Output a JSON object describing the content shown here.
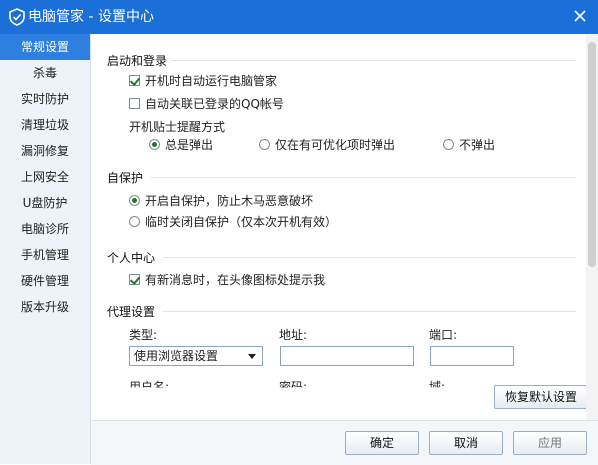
{
  "window": {
    "title": "电脑管家 - 设置中心"
  },
  "sidebar": {
    "items": [
      {
        "label": "常规设置",
        "active": true
      },
      {
        "label": "杀毒"
      },
      {
        "label": "实时防护"
      },
      {
        "label": "清理垃圾"
      },
      {
        "label": "漏洞修复"
      },
      {
        "label": "上网安全"
      },
      {
        "label": "U盘防护"
      },
      {
        "label": "电脑诊所"
      },
      {
        "label": "手机管理"
      },
      {
        "label": "硬件管理"
      },
      {
        "label": "版本升级"
      }
    ]
  },
  "startup": {
    "title": "启动和登录",
    "auto_run": {
      "label": "开机时自动运行电脑管家",
      "checked": true
    },
    "auto_qq": {
      "label": "自动关联已登录的QQ帐号",
      "checked": false
    },
    "tips_label": "开机贴士提醒方式",
    "tips_options": [
      {
        "label": "总是弹出",
        "checked": true
      },
      {
        "label": "仅在有可优化项时弹出",
        "checked": false
      },
      {
        "label": "不弹出",
        "checked": false
      }
    ]
  },
  "selfprotect": {
    "title": "自保护",
    "options": [
      {
        "label": "开启自保护，防止木马恶意破坏",
        "checked": true
      },
      {
        "label": "临时关闭自保护（仅本次开机有效）",
        "checked": false
      }
    ]
  },
  "personal": {
    "title": "个人中心",
    "notify": {
      "label": "有新消息时，在头像图标处提示我",
      "checked": true
    }
  },
  "proxy": {
    "title": "代理设置",
    "type_label": "类型:",
    "address_label": "地址:",
    "port_label": "端口:",
    "type_value": "使用浏览器设置",
    "address_value": "",
    "port_value": "",
    "username_label": "用户名:",
    "password_label": "密码:",
    "domain_label": "域:",
    "restore_label": "恢复默认设置"
  },
  "footer": {
    "ok_label": "确定",
    "cancel_label": "取消",
    "apply_label": "应用"
  },
  "colors": {
    "accent": "#1b6fd8",
    "sidebar_active": "#2f7fe0"
  }
}
